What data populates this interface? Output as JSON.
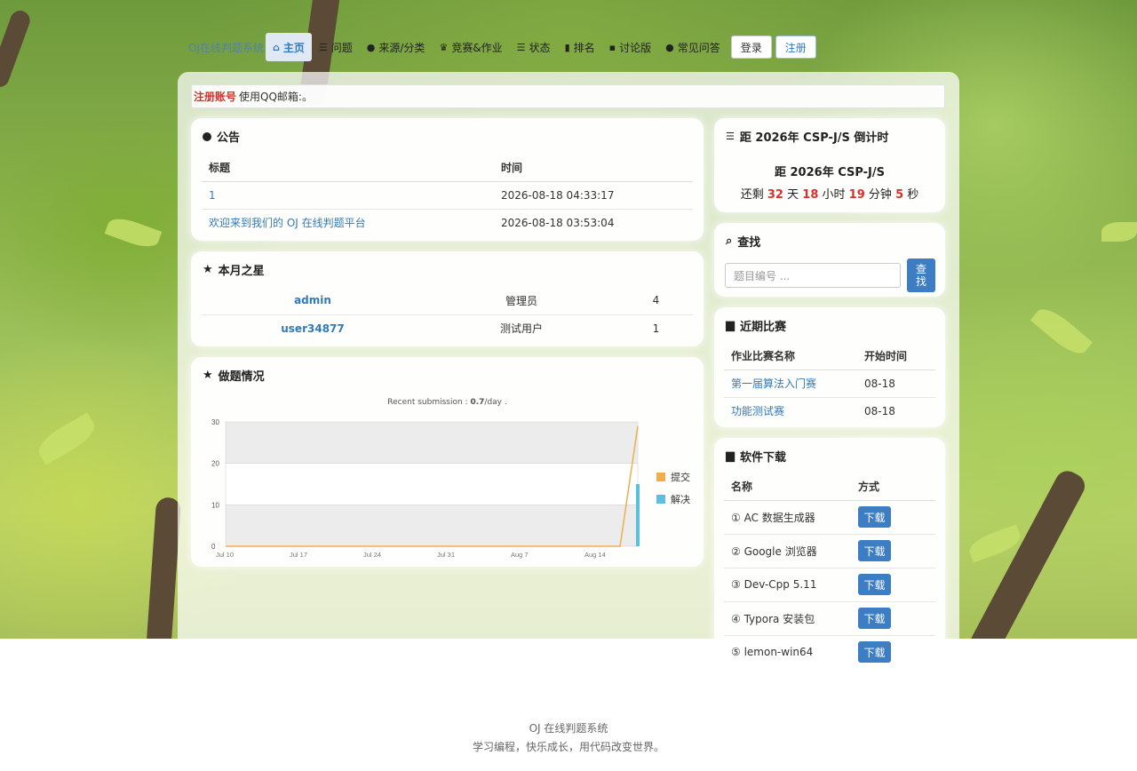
{
  "nav": {
    "brand": "OJ在线判题系统",
    "items": [
      {
        "icon": "home-icon",
        "glyph": "⌂",
        "label": "主页",
        "active": true
      },
      {
        "icon": "list-icon",
        "glyph": "☰",
        "label": "问题"
      },
      {
        "icon": "dot-icon",
        "glyph": "●",
        "label": "来源/分类"
      },
      {
        "icon": "trophy-icon",
        "glyph": "🏆",
        "label": "竞赛&作业"
      },
      {
        "icon": "status-icon",
        "glyph": "☰",
        "label": "状态"
      },
      {
        "icon": "bar-chart-icon",
        "glyph": "▮",
        "label": "排名"
      },
      {
        "icon": "comment-icon",
        "glyph": "▪",
        "label": "讨论版"
      },
      {
        "icon": "faq-icon",
        "glyph": "●",
        "label": "常见问答"
      }
    ],
    "login": "登录",
    "register": "注册"
  },
  "notice": {
    "highlight": "注册账号",
    "text": "使用QQ邮箱:。"
  },
  "announcements": {
    "title": "公告",
    "headers": [
      "标题",
      "时间"
    ],
    "rows": [
      {
        "title": "1",
        "time": "2026-08-18 04:33:17"
      },
      {
        "title": "欢迎来到我们的 OJ 在线判题平台",
        "time": "2026-08-18 03:53:04"
      }
    ]
  },
  "stars": {
    "title": "本月之星",
    "rows": [
      {
        "user": "admin",
        "role": "管理员",
        "count": "4"
      },
      {
        "user": "user34877",
        "role": "测试用户",
        "count": "1"
      }
    ]
  },
  "activity": {
    "title": "做题情况",
    "caption_prefix": "Recent submission : ",
    "caption_value": "0.7",
    "caption_suffix": "/day ."
  },
  "chart_data": {
    "type": "line",
    "x": [
      "Jul 10",
      "Jul 17",
      "Jul 24",
      "Jul 31",
      "Aug 7",
      "Aug 14"
    ],
    "ylim": [
      0,
      30
    ],
    "yticks": [
      "30",
      "20",
      "10",
      "0"
    ],
    "series": [
      {
        "name": "提交",
        "color": "#f0ad4e",
        "points": [
          [
            0,
            0
          ],
          [
            0.957,
            0
          ],
          [
            1.0,
            29
          ]
        ]
      },
      {
        "name": "解决",
        "color": "#5bc0de",
        "bar": {
          "x": 1.0,
          "value": 15
        }
      }
    ],
    "grid": true,
    "legend": "right"
  },
  "countdown": {
    "title": "距 2026年 CSP-J/S 倒计时",
    "subtitle": "距 2026年 CSP-J/S",
    "prefix": "还剩",
    "days": "32",
    "days_unit": "天",
    "hours": "18",
    "hours_unit": "小时",
    "minutes": "19",
    "minutes_unit": "分钟",
    "seconds": "5",
    "seconds_unit": "秒"
  },
  "search": {
    "title": "查找",
    "placeholder": "题目编号 ...",
    "button": "查找"
  },
  "contests": {
    "title": "近期比赛",
    "headers": [
      "作业比赛名称",
      "开始时间"
    ],
    "rows": [
      {
        "name": "第一届算法入门赛",
        "date": "08-18"
      },
      {
        "name": "功能测试赛",
        "date": "08-18"
      }
    ]
  },
  "downloads": {
    "title": "软件下载",
    "headers": [
      "名称",
      "方式"
    ],
    "button": "下载",
    "rows": [
      {
        "name": "① AC 数据生成器"
      },
      {
        "name": "② Google 浏览器"
      },
      {
        "name": "③ Dev-Cpp 5.11"
      },
      {
        "name": "④ Typora 安装包"
      },
      {
        "name": "⑤ lemon-win64"
      }
    ]
  },
  "footer": {
    "line1": "OJ 在线判题系统",
    "line2": "学习编程，快乐成长，用代码改变世界。"
  }
}
